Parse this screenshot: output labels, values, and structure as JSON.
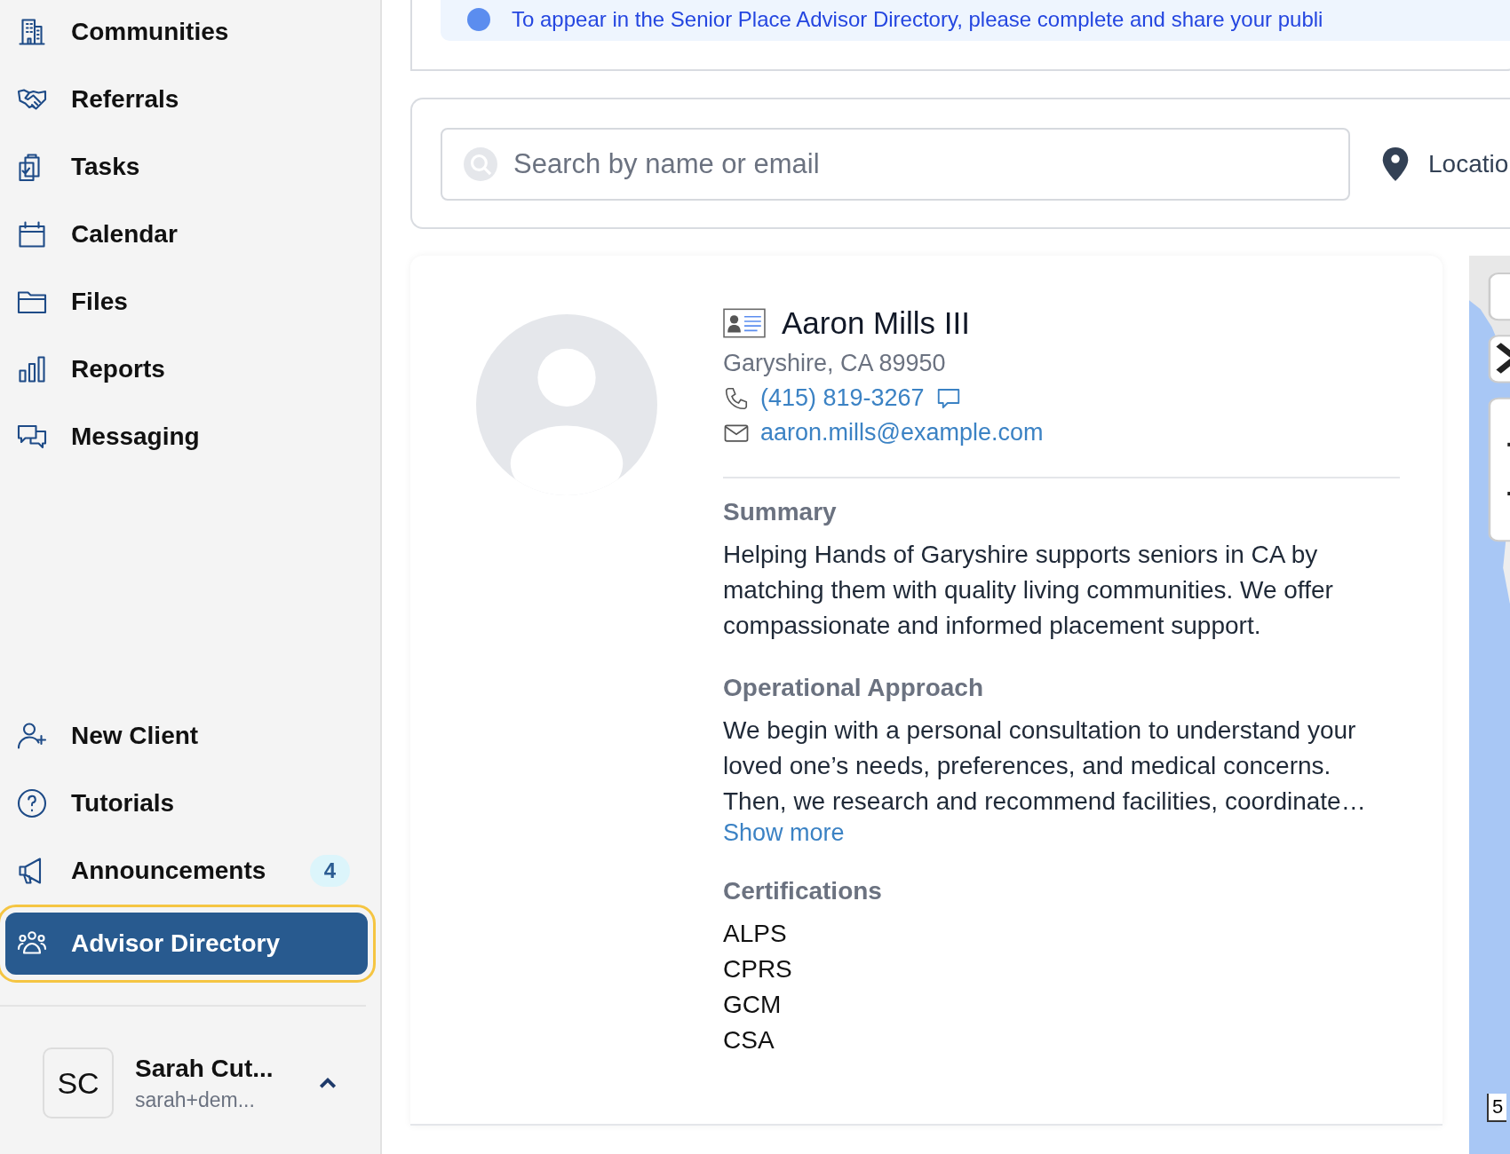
{
  "sidebar": {
    "nav_items": [
      {
        "label": "Communities",
        "selected": false
      },
      {
        "label": "Referrals",
        "selected": false
      },
      {
        "label": "Tasks",
        "selected": false
      },
      {
        "label": "Calendar",
        "selected": false
      },
      {
        "label": "Files",
        "selected": false
      },
      {
        "label": "Reports",
        "selected": false
      },
      {
        "label": "Messaging",
        "selected": false
      }
    ],
    "bottom_items": [
      {
        "label": "New Client",
        "selected": false
      },
      {
        "label": "Tutorials",
        "selected": false
      },
      {
        "label": "Announcements",
        "selected": false,
        "badge": "4"
      },
      {
        "label": "Advisor Directory",
        "selected": true
      }
    ],
    "user": {
      "initials": "SC",
      "name": "Sarah Cut...",
      "email": "sarah+dem..."
    }
  },
  "notice": {
    "text": "To appear in the Senior Place Advisor Directory, please complete and share your publi"
  },
  "search": {
    "placeholder": "Search by name or email",
    "location_label": "Locatio"
  },
  "advisor": {
    "name": "Aaron Mills III",
    "address": "Garyshire, CA 89950",
    "phone": "(415) 819-3267",
    "email": "aaron.mills@example.com",
    "sections": [
      {
        "heading": "Summary",
        "kind": "text",
        "text": "Helping Hands of Garyshire supports seniors in CA by matching them with quality living communities. We offer compassionate and informed placement support."
      },
      {
        "heading": "Operational Approach",
        "kind": "text",
        "text": "We begin with a personal consultation to understand your loved one’s needs, preferences, and medical concerns. Then, we research and recommend facilities, coordinate…",
        "more_link": "Show more"
      },
      {
        "heading": "Certifications",
        "kind": "list",
        "items": [
          "ALPS",
          "CPRS",
          "GCM",
          "CSA"
        ]
      }
    ]
  },
  "map": {
    "scale_label": "5"
  }
}
